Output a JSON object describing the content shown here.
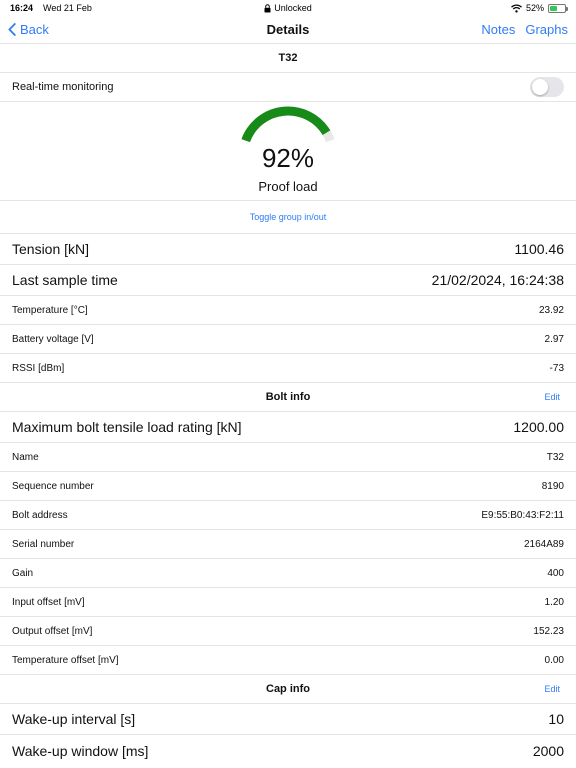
{
  "status_bar": {
    "time": "16:24",
    "date": "Wed 21 Feb",
    "lock_text": "Unlocked",
    "battery": "52%",
    "battery_level": 0.52
  },
  "nav": {
    "back": "Back",
    "title": "Details",
    "notes": "Notes",
    "graphs": "Graphs"
  },
  "device_name": "T32",
  "realtime": {
    "label": "Real-time monitoring",
    "enabled": false
  },
  "gauge": {
    "percent_text": "92%",
    "value": 0.92,
    "label": "Proof load",
    "color": "#178a17",
    "track_color": "#e8e8e8"
  },
  "toggle_group": "Toggle group in/out",
  "readings": [
    {
      "label": "Tension [kN]",
      "value": "1100.46",
      "size": "big"
    },
    {
      "label": "Last sample time",
      "value": "21/02/2024, 16:24:38",
      "size": "big"
    },
    {
      "label": "Temperature [°C]",
      "value": "23.92",
      "size": "small"
    },
    {
      "label": "Battery voltage [V]",
      "value": "2.97",
      "size": "small"
    },
    {
      "label": "RSSI [dBm]",
      "value": "-73",
      "size": "small"
    }
  ],
  "bolt_info": {
    "title": "Bolt info",
    "edit": "Edit",
    "rows": [
      {
        "label": "Maximum bolt tensile load rating [kN]",
        "value": "1200.00",
        "size": "big"
      },
      {
        "label": "Name",
        "value": "T32",
        "size": "small"
      },
      {
        "label": "Sequence number",
        "value": "8190",
        "size": "small"
      },
      {
        "label": "Bolt address",
        "value": "E9:55:B0:43:F2:11",
        "size": "small"
      },
      {
        "label": "Serial number",
        "value": "2164A89",
        "size": "small"
      },
      {
        "label": "Gain",
        "value": "400",
        "size": "small"
      },
      {
        "label": "Input offset [mV]",
        "value": "1.20",
        "size": "small"
      },
      {
        "label": "Output offset [mV]",
        "value": "152.23",
        "size": "small"
      },
      {
        "label": "Temperature offset [mV]",
        "value": "0.00",
        "size": "small"
      }
    ]
  },
  "cap_info": {
    "title": "Cap info",
    "edit": "Edit",
    "rows": [
      {
        "label": "Wake-up interval [s]",
        "value": "10",
        "size": "big"
      },
      {
        "label": "Wake-up window [ms]",
        "value": "2000",
        "size": "big"
      }
    ]
  },
  "colors": {
    "accent": "#2f7cf6"
  }
}
